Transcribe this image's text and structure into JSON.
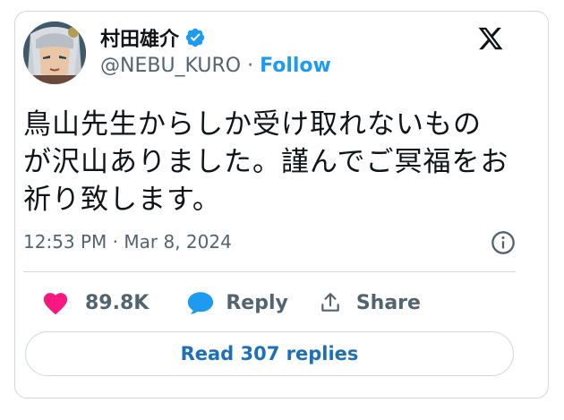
{
  "author": {
    "display_name": "村田雄介",
    "handle": "@NEBU_KURO",
    "separator": "·",
    "follow_label": "Follow"
  },
  "tweet": {
    "text_lines": [
      "鳥山先生からしか受け取れないもの",
      "が沢山ありました。謹んでご冥福をお",
      "祈り致します。"
    ],
    "time": "12:53 PM",
    "date": "Mar 8, 2024",
    "meta_separator": "·"
  },
  "actions": {
    "like_count": "89.8K",
    "reply_label": "Reply",
    "share_label": "Share"
  },
  "read_replies_label": "Read 307 replies",
  "colors": {
    "like": "#f91880",
    "reply": "#1d9bf0",
    "follow": "#1d9bf0",
    "read_replies": "#1d6fb8",
    "verified": "#1d9bf0"
  },
  "icons": [
    "verified-badge-icon",
    "x-logo-icon",
    "info-icon",
    "heart-icon",
    "reply-bubble-icon",
    "share-icon"
  ]
}
